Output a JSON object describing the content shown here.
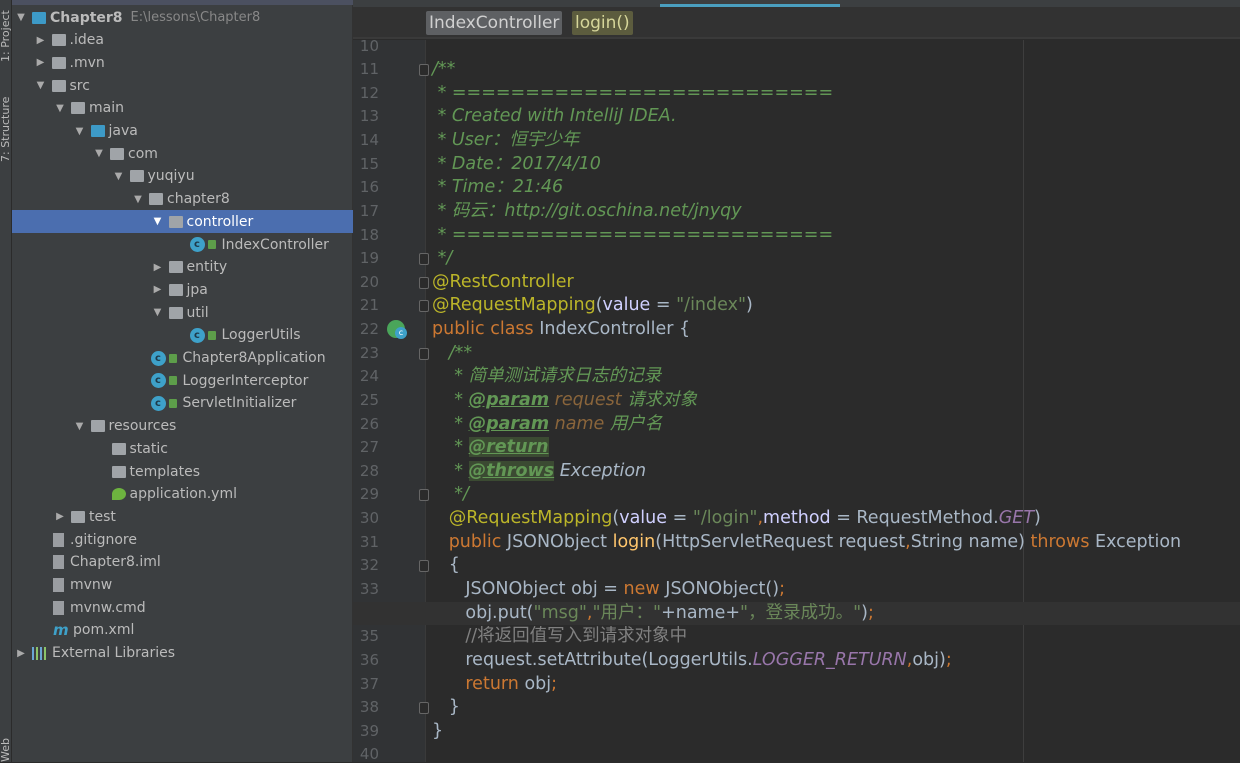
{
  "toolwindows": {
    "project": "1: Project",
    "structure": "7: Structure",
    "web": "Web"
  },
  "project": {
    "root": {
      "name": "Chapter8",
      "path": "E:\\lessons\\Chapter8"
    },
    "items": [
      {
        "label": "Chapter8",
        "depth": 0,
        "arrow": "down",
        "icon": "module",
        "root": true
      },
      {
        "label": ".idea",
        "depth": 1,
        "arrow": "right",
        "icon": "folder"
      },
      {
        "label": ".mvn",
        "depth": 1,
        "arrow": "right",
        "icon": "folder"
      },
      {
        "label": "src",
        "depth": 1,
        "arrow": "down",
        "icon": "folder"
      },
      {
        "label": "main",
        "depth": 2,
        "arrow": "down",
        "icon": "folder"
      },
      {
        "label": "java",
        "depth": 3,
        "arrow": "down",
        "icon": "source-folder"
      },
      {
        "label": "com",
        "depth": 4,
        "arrow": "down",
        "icon": "package"
      },
      {
        "label": "yuqiyu",
        "depth": 5,
        "arrow": "down",
        "icon": "package"
      },
      {
        "label": "chapter8",
        "depth": 6,
        "arrow": "down",
        "icon": "package"
      },
      {
        "label": "controller",
        "depth": 7,
        "arrow": "down",
        "icon": "package",
        "selected": true
      },
      {
        "label": "IndexController",
        "depth": 9,
        "icon": "class"
      },
      {
        "label": "entity",
        "depth": 7,
        "arrow": "right",
        "icon": "package"
      },
      {
        "label": "jpa",
        "depth": 7,
        "arrow": "right",
        "icon": "package"
      },
      {
        "label": "util",
        "depth": 7,
        "arrow": "down",
        "icon": "package"
      },
      {
        "label": "LoggerUtils",
        "depth": 9,
        "icon": "class"
      },
      {
        "label": "Chapter8Application",
        "depth": 7,
        "icon": "class"
      },
      {
        "label": "LoggerInterceptor",
        "depth": 7,
        "icon": "class"
      },
      {
        "label": "ServletInitializer",
        "depth": 7,
        "icon": "class"
      },
      {
        "label": "resources",
        "depth": 3,
        "arrow": "down",
        "icon": "resources-folder"
      },
      {
        "label": "static",
        "depth": 5,
        "icon": "folder"
      },
      {
        "label": "templates",
        "depth": 5,
        "icon": "folder"
      },
      {
        "label": "application.yml",
        "depth": 5,
        "icon": "spring-yml"
      },
      {
        "label": "test",
        "depth": 2,
        "arrow": "right",
        "icon": "folder"
      },
      {
        "label": ".gitignore",
        "depth": 2,
        "icon": "file"
      },
      {
        "label": "Chapter8.iml",
        "depth": 2,
        "icon": "file"
      },
      {
        "label": "mvnw",
        "depth": 2,
        "icon": "file"
      },
      {
        "label": "mvnw.cmd",
        "depth": 2,
        "icon": "file"
      },
      {
        "label": "pom.xml",
        "depth": 2,
        "icon": "maven"
      },
      {
        "label": "External Libraries",
        "depth": 0,
        "arrow": "right",
        "icon": "libraries"
      }
    ]
  },
  "breadcrumbs": [
    "IndexController",
    "login()"
  ],
  "editor": {
    "first_line": 10,
    "current_line": 34,
    "lines": [
      [],
      [
        [
          "/**",
          "cm"
        ]
      ],
      [
        [
          " * ==========================",
          "cm"
        ]
      ],
      [
        [
          " * Created with IntelliJ IDEA.",
          "cm"
        ]
      ],
      [
        [
          " * User：恒宇少年",
          "cm"
        ]
      ],
      [
        [
          " * Date：2017/4/10",
          "cm"
        ]
      ],
      [
        [
          " * Time：21:46",
          "cm"
        ]
      ],
      [
        [
          " * 码云：http://git.oschina.net/jnyqy",
          "cm"
        ]
      ],
      [
        [
          " * ==========================",
          "cm"
        ]
      ],
      [
        [
          " */",
          "cm"
        ]
      ],
      [
        [
          "@RestController",
          "ann"
        ]
      ],
      [
        [
          "@RequestMapping",
          "ann"
        ],
        [
          "(",
          ""
        ],
        [
          "value",
          "nm"
        ],
        [
          " = ",
          ""
        ],
        [
          "\"/index\"",
          "str"
        ],
        [
          ")",
          ""
        ]
      ],
      [
        [
          "public class ",
          "kw"
        ],
        [
          "IndexController {",
          ""
        ]
      ],
      [
        [
          "   /**",
          "cm"
        ]
      ],
      [
        [
          "    * 简单测试请求日志的记录",
          "cm"
        ]
      ],
      [
        [
          "    * ",
          "cm"
        ],
        [
          "@param",
          "tag"
        ],
        [
          " request",
          "pn"
        ],
        [
          " 请求对象",
          "cm"
        ]
      ],
      [
        [
          "    * ",
          "cm"
        ],
        [
          "@param",
          "tag"
        ],
        [
          " name",
          "pn"
        ],
        [
          " 用户名",
          "cm"
        ]
      ],
      [
        [
          "    * ",
          "cm"
        ],
        [
          "@return",
          "tag tagbg"
        ]
      ],
      [
        [
          "    * ",
          "cm"
        ],
        [
          "@throws",
          "tag tagbg"
        ],
        [
          " Exception",
          "ex"
        ]
      ],
      [
        [
          "    */",
          "cm"
        ]
      ],
      [
        [
          "   ",
          ""
        ],
        [
          "@RequestMapping",
          "ann"
        ],
        [
          "(",
          ""
        ],
        [
          "value",
          "nm"
        ],
        [
          " = ",
          ""
        ],
        [
          "\"/login\"",
          "str"
        ],
        [
          ",",
          "kw"
        ],
        [
          "method",
          "nm"
        ],
        [
          " = RequestMethod.",
          ""
        ],
        [
          "GET",
          "const"
        ],
        [
          ")",
          ""
        ]
      ],
      [
        [
          "   public ",
          "kw"
        ],
        [
          "JSONObject ",
          ""
        ],
        [
          "login",
          "fn"
        ],
        [
          "(HttpServletRequest request",
          ""
        ],
        [
          ",",
          "kw"
        ],
        [
          "String name) ",
          ""
        ],
        [
          "throws ",
          "kw"
        ],
        [
          "Exception",
          ""
        ]
      ],
      [
        [
          "   {",
          ""
        ]
      ],
      [
        [
          "      JSONObject obj = ",
          ""
        ],
        [
          "new ",
          "kw"
        ],
        [
          "JSONObject()",
          ""
        ],
        [
          ";",
          "kw"
        ]
      ],
      [
        [
          "      obj.put(",
          ""
        ],
        [
          "\"msg\"",
          "str"
        ],
        [
          ",",
          "kw"
        ],
        [
          "\"用户：\"",
          "str"
        ],
        [
          "+name+",
          ""
        ],
        [
          "\"，登录成功。\"",
          "str"
        ],
        [
          ")",
          ""
        ],
        [
          ";",
          "kw"
        ]
      ],
      [
        [
          "      //将返回值写入到请求对象中",
          "lc"
        ]
      ],
      [
        [
          "      request.setAttribute(LoggerUtils.",
          ""
        ],
        [
          "LOGGER_RETURN",
          "const"
        ],
        [
          ",",
          "kw"
        ],
        [
          "obj)",
          ""
        ],
        [
          ";",
          "kw"
        ]
      ],
      [
        [
          "      return ",
          "kw"
        ],
        [
          "obj",
          ""
        ],
        [
          ";",
          "kw"
        ]
      ],
      [
        [
          "   }",
          ""
        ]
      ],
      [
        [
          "}",
          ""
        ]
      ],
      []
    ],
    "folds": [
      11,
      19,
      20,
      21,
      23,
      29,
      32,
      38
    ]
  },
  "colors": {
    "selection": "#4b6eaf",
    "keyword": "#cc7832",
    "annotation": "#bbb529",
    "string": "#6a8759",
    "doc_comment": "#629755",
    "background": "#2b2b2b"
  }
}
